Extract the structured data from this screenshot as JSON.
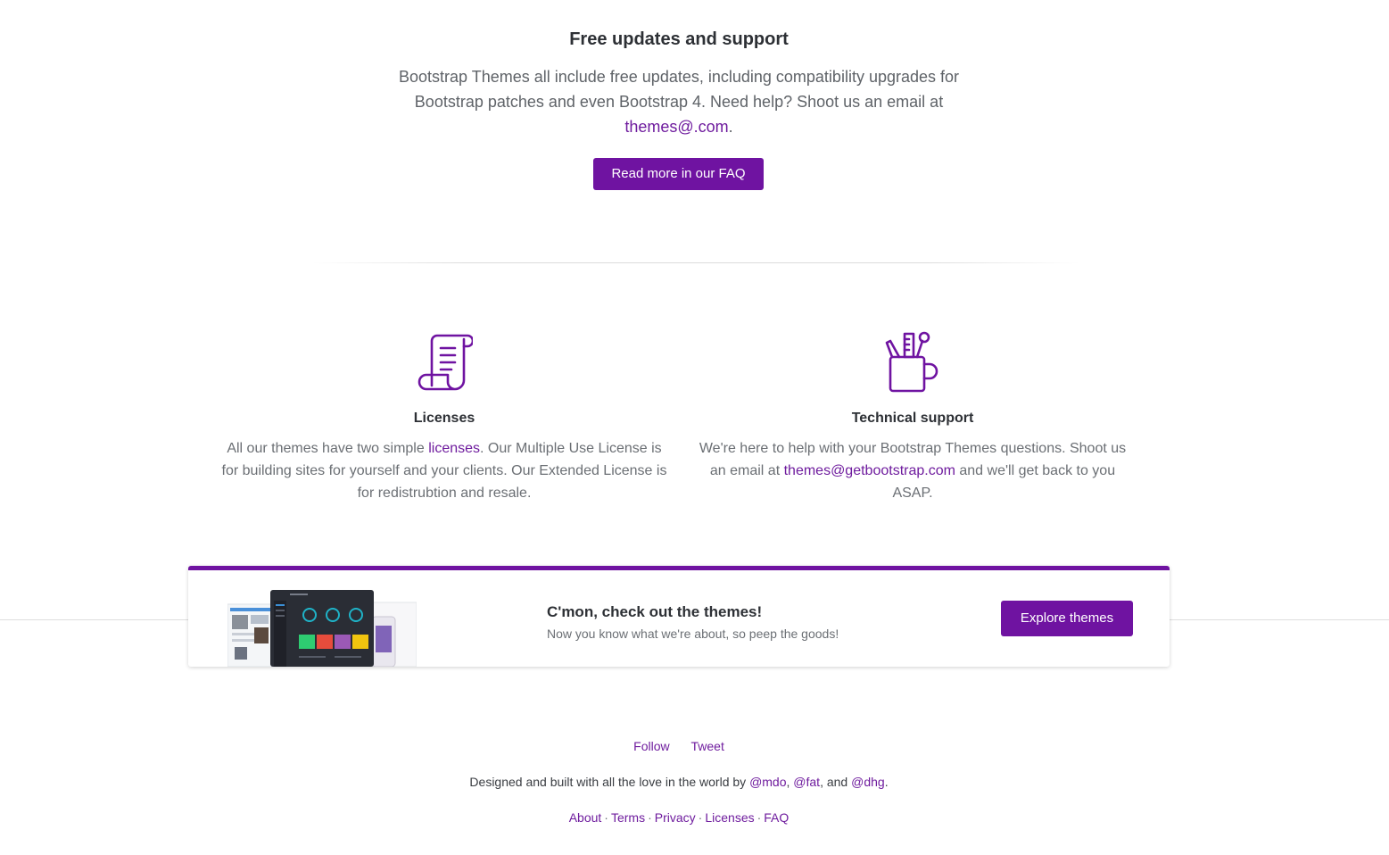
{
  "support": {
    "title": "Free updates and support",
    "text_before": "Bootstrap Themes all include free updates, including compatibility upgrades for Bootstrap patches and even Bootstrap 4. Need help? Shoot us an email at ",
    "email": "themes@.com",
    "text_after": ".",
    "faq_button": "Read more in our FAQ"
  },
  "features": {
    "licenses": {
      "icon": "scroll-icon",
      "title": "Licenses",
      "text_before": "All our themes have two simple ",
      "link": "licenses",
      "text_after": ". Our Multiple Use License is for building sites for yourself and your clients. Our Extended License is for redistrubtion and resale."
    },
    "support": {
      "icon": "tools-cup-icon",
      "title": "Technical support",
      "text_before": "We're here to help with your Bootstrap Themes questions. Shoot us an email at ",
      "link": "themes@getbootstrap.com",
      "text_after": " and we'll get back to you ASAP."
    }
  },
  "promo": {
    "title": "C'mon, check out the themes!",
    "subtitle": "Now you know what we're about, so peep the goods!",
    "button": "Explore themes"
  },
  "footer": {
    "social": [
      "Follow",
      "Tweet"
    ],
    "credit_before": "Designed and built with all the love in the world by ",
    "authors": [
      "@mdo",
      "@fat",
      "@dhg"
    ],
    "links": [
      "About",
      "Terms",
      "Privacy",
      "Licenses",
      "FAQ"
    ]
  },
  "colors": {
    "accent": "#6f13a1",
    "link": "#6f1c9e",
    "heading": "#2d3035",
    "text": "#5f6368"
  }
}
